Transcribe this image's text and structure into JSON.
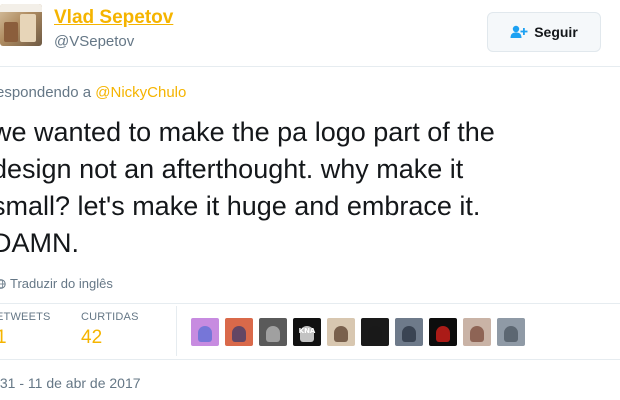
{
  "author": {
    "name": "Vlad Sepetov",
    "handle": "@VSepetov"
  },
  "follow_button": {
    "label": "Seguir",
    "icon": "follow-person-plus-icon"
  },
  "reply": {
    "prefix": "espondendo a ",
    "mention": "@NickyChulo"
  },
  "tweet": {
    "lines": [
      "we wanted to make the pa logo part of the",
      "design not an afterthought. why make it",
      "small? let's make it huge and embrace it.",
      "DAMN."
    ]
  },
  "translate": {
    "label": "Traduzir do inglês",
    "icon": "globe-icon"
  },
  "stats": {
    "retweets_label": "ETWEETS",
    "retweets_value": "1",
    "likes_label": "CURTIDAS",
    "likes_value": "42"
  },
  "likers": [
    {
      "icon": "liker-avatar",
      "bg": "#c78be0",
      "fg": "#5b6fd6"
    },
    {
      "icon": "liker-avatar",
      "bg": "#d9694a",
      "fg": "#3b3b6e"
    },
    {
      "icon": "liker-avatar",
      "bg": "#5a5a5a",
      "fg": "#b8b8b8"
    },
    {
      "icon": "liker-avatar",
      "bg": "#111111",
      "fg": "#ffffff",
      "mark": "KNA"
    },
    {
      "icon": "liker-avatar",
      "bg": "#d8c7b0",
      "fg": "#5a3e2b"
    },
    {
      "icon": "liker-avatar",
      "bg": "#1a1a1a",
      "fg": "#1a1a1a"
    },
    {
      "icon": "liker-avatar",
      "bg": "#6e7a8a",
      "fg": "#2a3340"
    },
    {
      "icon": "liker-avatar",
      "bg": "#0d0d0d",
      "fg": "#e0201b"
    },
    {
      "icon": "liker-avatar",
      "bg": "#c9b3a6",
      "fg": "#7a4a3a"
    },
    {
      "icon": "liker-avatar",
      "bg": "#8f9aa6",
      "fg": "#4b5560"
    }
  ],
  "timestamp": ":31 - 11 de abr de 2017",
  "colors": {
    "accent": "#f5b400",
    "muted": "#657786",
    "text": "#14171a",
    "border": "#e6ecf0"
  }
}
